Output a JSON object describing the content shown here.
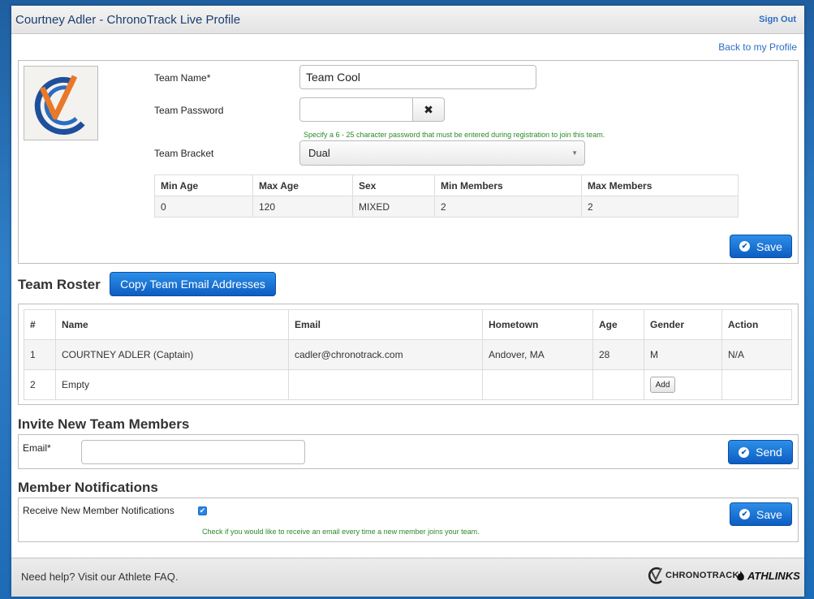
{
  "header": {
    "title": "Courtney Adler - ChronoTrack Live Profile",
    "sign_out": "Sign Out"
  },
  "back_link": "Back to my Profile",
  "team_form": {
    "team_name_label": "Team Name*",
    "team_name_value": "Team Cool",
    "password_label": "Team Password",
    "password_value": "",
    "password_hint": "Specify a 6 - 25 character password that must be entered during registration to join this team.",
    "bracket_label": "Team Bracket",
    "bracket_value": "Dual",
    "bracket_table": {
      "headers": [
        "Min Age",
        "Max Age",
        "Sex",
        "Min Members",
        "Max Members"
      ],
      "row": [
        "0",
        "120",
        "MIXED",
        "2",
        "2"
      ]
    },
    "save_label": "Save"
  },
  "roster": {
    "title": "Team Roster",
    "copy_label": "Copy Team Email Addresses",
    "headers": [
      "#",
      "Name",
      "Email",
      "Hometown",
      "Age",
      "Gender",
      "Action"
    ],
    "rows": [
      [
        "1",
        "COURTNEY ADLER (Captain)",
        "cadler@chronotrack.com",
        "Andover, MA",
        "28",
        "M",
        "N/A"
      ],
      [
        "2",
        "Empty",
        "",
        "",
        "",
        "",
        ""
      ]
    ],
    "add_label": "Add"
  },
  "invite": {
    "title": "Invite New Team Members",
    "email_label": "Email*",
    "email_value": "",
    "send_label": "Send"
  },
  "notifications": {
    "title": "Member Notifications",
    "receive_label": "Receive New Member Notifications",
    "hint": "Check if you would like to receive an email every time a new member joins your team.",
    "save_label": "Save",
    "checked": true
  },
  "footer": {
    "help": "Need help? Visit our Athlete FAQ.",
    "brand1": "CHRONOTRACK",
    "brand2": "ATHLINKS"
  },
  "colors": {
    "primary_button": "#0d5dc2",
    "link": "#2a6fc4",
    "hint_green": "#2a8a2a"
  }
}
